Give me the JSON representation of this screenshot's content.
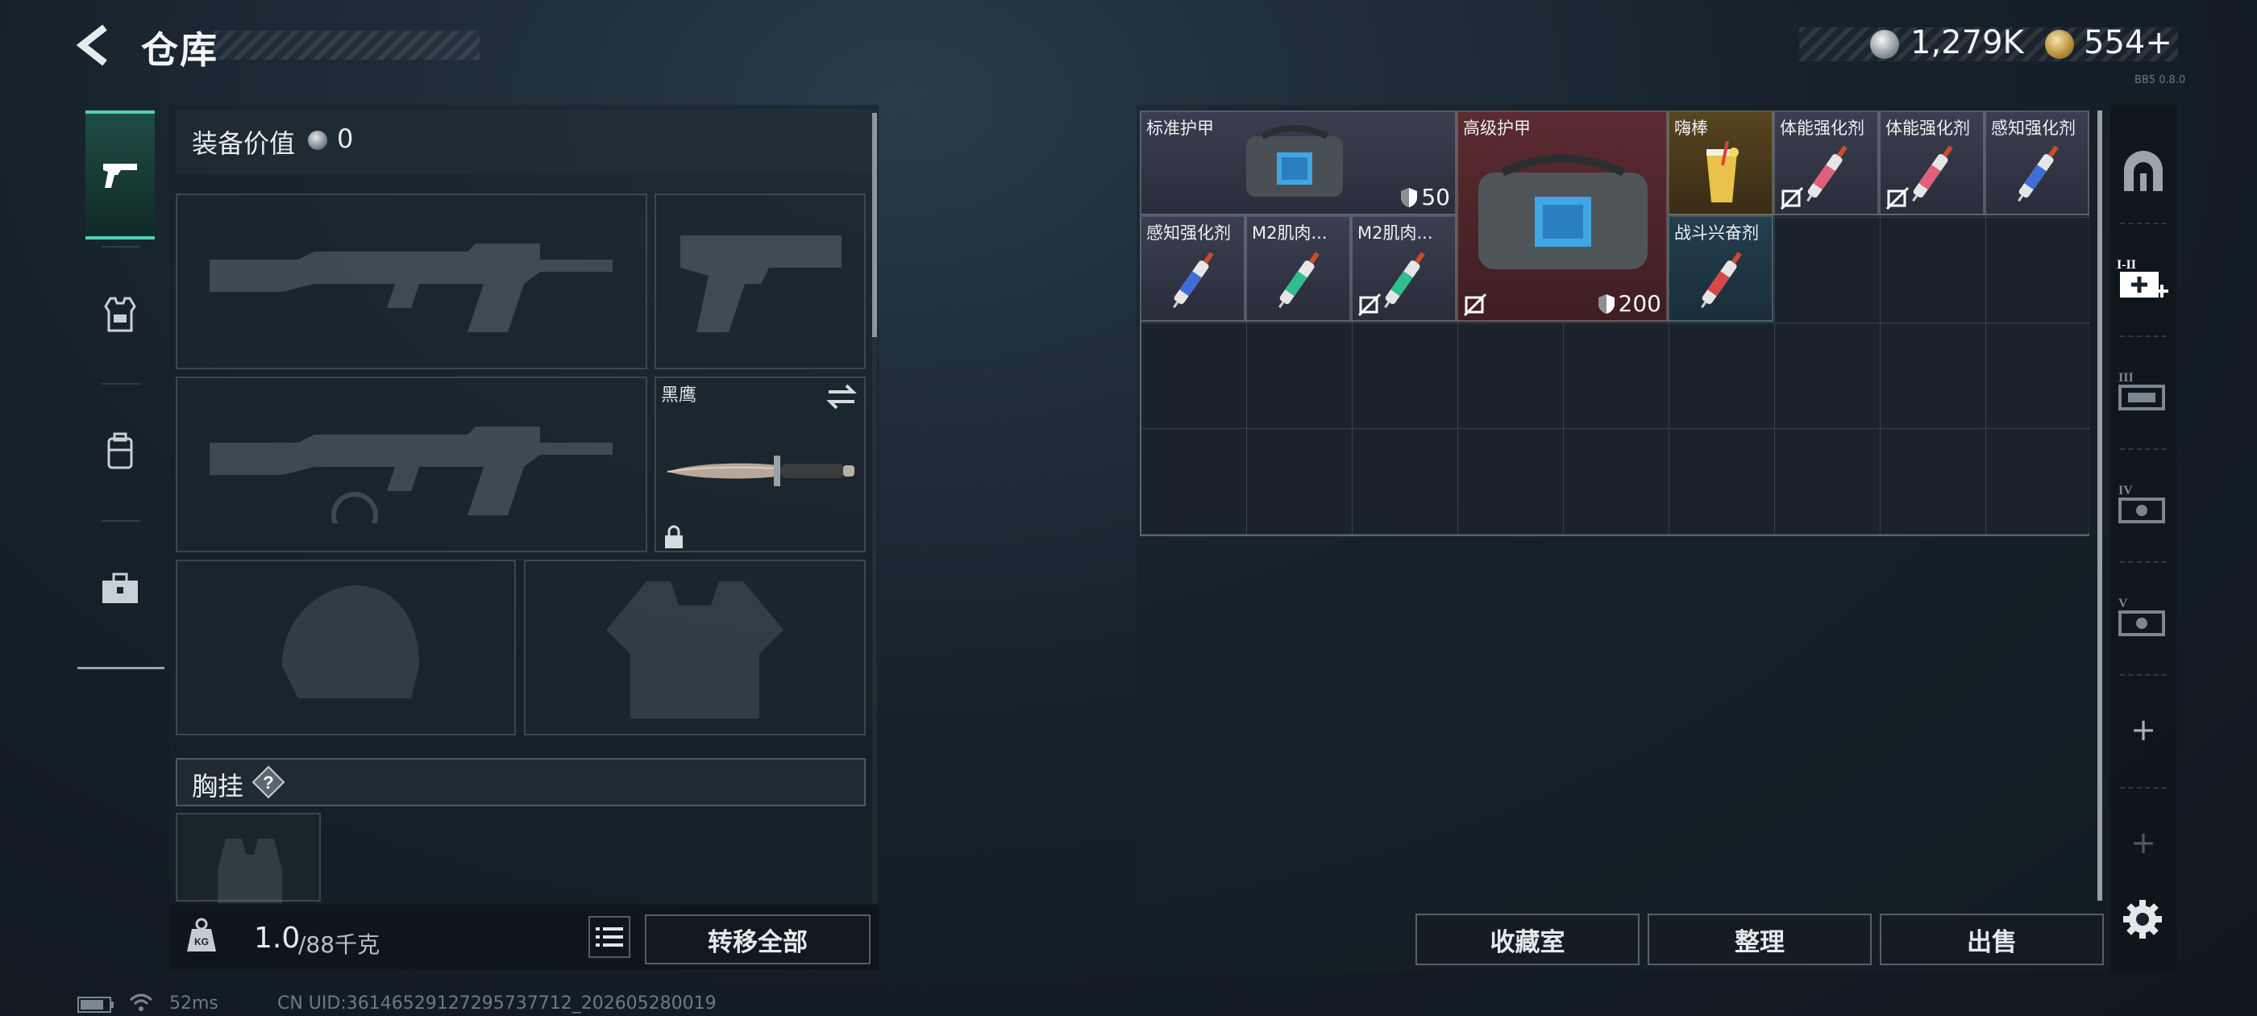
{
  "header": {
    "title": "仓库",
    "currency_silver": "1,279K",
    "currency_gold": "554+",
    "version": "BB5 0.8.0"
  },
  "left_tabs": [
    "weapons",
    "armor",
    "backpack",
    "toolbox"
  ],
  "loadout": {
    "equip_value_label": "装备价值",
    "equip_value": "0",
    "melee_name": "黑鹰",
    "chest_rig_label": "胸挂",
    "chest_rig_help": "?",
    "weight_current": "1.0",
    "weight_max": "/88千克",
    "transfer_all_label": "转移全部"
  },
  "status": {
    "ping": "52ms",
    "uid": "CN UID:36146529127295737712_202605280019"
  },
  "stash": {
    "items": [
      {
        "name": "标准护甲",
        "rarity": "gray",
        "durability": "50"
      },
      {
        "name": "高级护甲",
        "rarity": "red",
        "durability": "200"
      },
      {
        "name": "嗨棒",
        "rarity": "gold"
      },
      {
        "name": "体能强化剂",
        "rarity": "gray"
      },
      {
        "name": "体能强化剂",
        "rarity": "gray"
      },
      {
        "name": "感知强化剂",
        "rarity": "gray"
      },
      {
        "name": "感知强化剂",
        "rarity": "gray"
      },
      {
        "name": "M2肌肉...",
        "rarity": "gray"
      },
      {
        "name": "M2肌肉...",
        "rarity": "gray"
      },
      {
        "name": "战斗兴奋剂",
        "rarity": "blue"
      }
    ]
  },
  "right_tabs": [
    "I-II",
    "III",
    "IV",
    "V"
  ],
  "right_tabs_plus": [
    "+",
    "+"
  ],
  "actions": {
    "collection": "收藏室",
    "sort": "整理",
    "sell": "出售"
  },
  "colors": {
    "accent": "#4fd3b8",
    "rarity_red": "#5b2b30",
    "rarity_gold": "#57441f",
    "rarity_blue": "#243e4e"
  }
}
